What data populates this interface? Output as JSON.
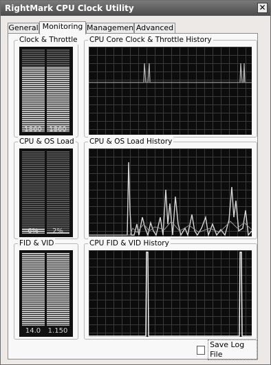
{
  "window": {
    "title": "RightMark CPU Clock Utility",
    "close_glyph": "✕"
  },
  "tabs": [
    {
      "label": "General",
      "active": false
    },
    {
      "label": "Monitoring",
      "active": true
    },
    {
      "label": "Management",
      "active": false
    },
    {
      "label": "Advanced",
      "active": false
    }
  ],
  "groups": {
    "clock_throttle": {
      "title": "Clock & Throttle",
      "bars": [
        {
          "label": "1860",
          "level": 0.78
        },
        {
          "label": "1860",
          "level": 0.78
        }
      ]
    },
    "clock_history": {
      "title": "CPU Core Clock & Throttle History"
    },
    "load": {
      "title": "CPU & OS Load",
      "bars": [
        {
          "label": "6%",
          "level": 0.06
        },
        {
          "label": "2%",
          "level": 0.02
        }
      ]
    },
    "load_history": {
      "title": "CPU & OS Load History"
    },
    "fidvid": {
      "title": "FID & VID",
      "bars": [
        {
          "label": "14.0",
          "level": 1.0
        },
        {
          "label": "1.150",
          "level": 1.0
        }
      ]
    },
    "fidvid_history": {
      "title": "CPU FID & VID History"
    }
  },
  "save_log_label": "Save Log File",
  "colors": {
    "title_bar": "#5a5a5a",
    "panel_bg": "#0c0c0c",
    "grid": "#3a3a3a",
    "trace": "#d8d8d8"
  }
}
